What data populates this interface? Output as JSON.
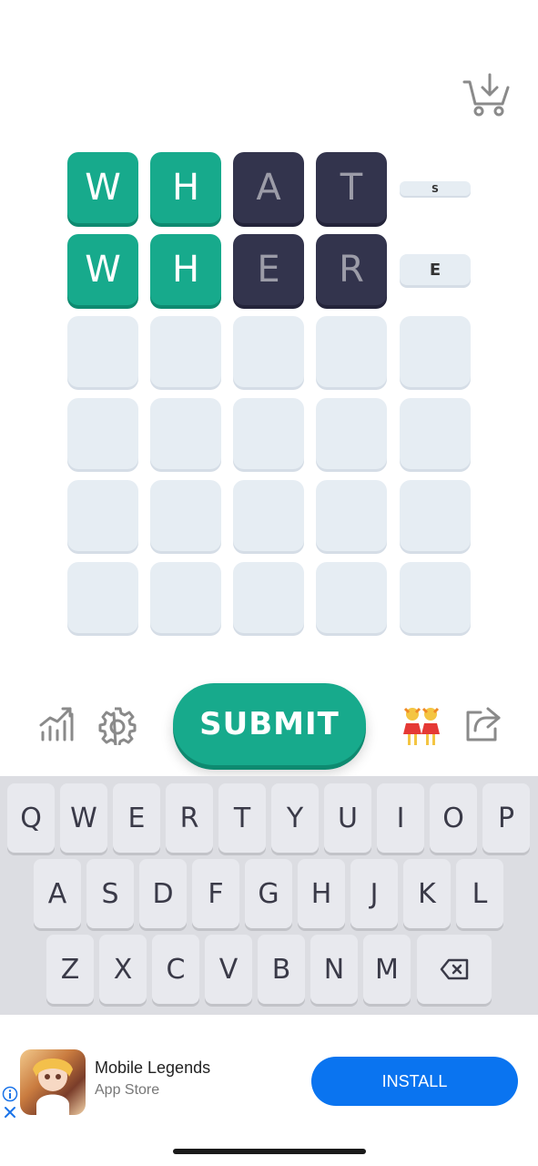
{
  "board": {
    "rows": [
      [
        "W",
        "H",
        "A",
        "T",
        ""
      ],
      [
        "W",
        "H",
        "E",
        "R",
        ""
      ],
      [
        "",
        "",
        "",
        "",
        ""
      ],
      [
        "",
        "",
        "",
        "",
        ""
      ],
      [
        "",
        "",
        "",
        "",
        ""
      ],
      [
        "",
        "",
        "",
        "",
        ""
      ]
    ],
    "row1_hint": "S",
    "row2_hint": "E"
  },
  "toolbar": {
    "submit_label": "SUBMIT",
    "stats_icon": "stats-icon",
    "settings_icon": "gear-icon",
    "friends_icon": "people-icon",
    "share_icon": "share-icon",
    "cart_icon": "cart-download-icon"
  },
  "keyboard": {
    "row1": [
      "Q",
      "W",
      "E",
      "R",
      "T",
      "Y",
      "U",
      "I",
      "O",
      "P"
    ],
    "row2": [
      "A",
      "S",
      "D",
      "F",
      "G",
      "H",
      "J",
      "K",
      "L"
    ],
    "row3": [
      "Z",
      "X",
      "C",
      "V",
      "B",
      "N",
      "M"
    ],
    "backspace_icon": "backspace-icon"
  },
  "ad": {
    "title": "Mobile Legends",
    "subtitle": "App Store",
    "install_label": "INSTALL"
  },
  "colors": {
    "correct": "#17aa8c",
    "absent": "#33344d",
    "empty": "#e6edf3",
    "install": "#0a74f0"
  }
}
